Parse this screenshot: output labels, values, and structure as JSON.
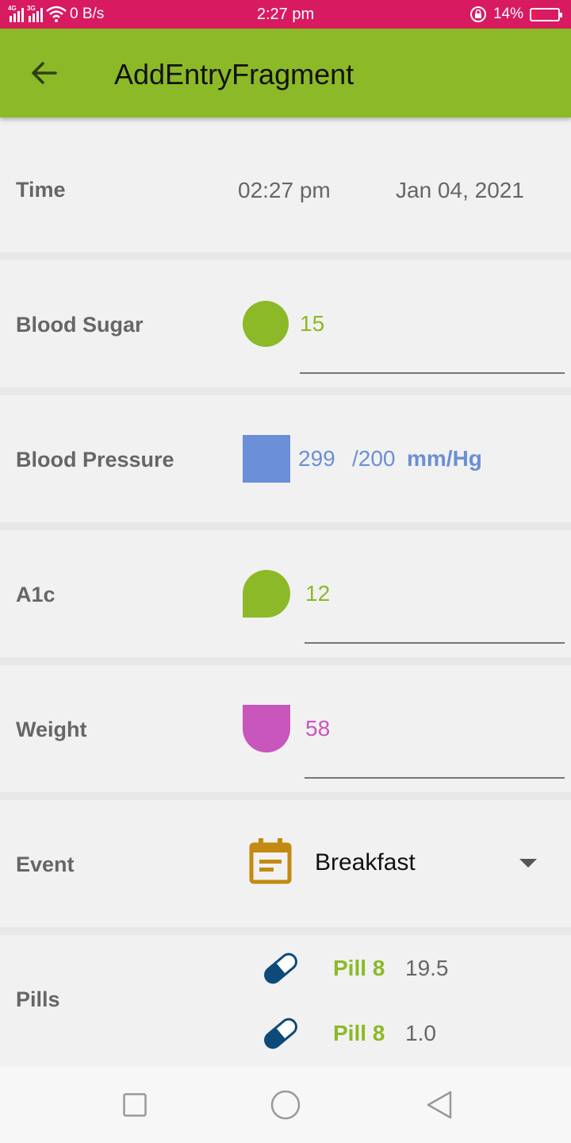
{
  "status_bar": {
    "net1": "4G",
    "net2": "3G",
    "speed": "0 B/s",
    "time": "2:27 pm",
    "battery": "14%",
    "battery_level": 0.14
  },
  "app_bar": {
    "title": "AddEntryFragment"
  },
  "form": {
    "time": {
      "label": "Time",
      "time_value": "02:27 pm",
      "date_value": "Jan 04, 2021"
    },
    "blood_sugar": {
      "label": "Blood Sugar",
      "value": "15",
      "color": "#8cb927"
    },
    "blood_pressure": {
      "label": "Blood Pressure",
      "systolic": "299",
      "diastolic": "/200",
      "unit": "mm/Hg",
      "color": "#6b8fd6"
    },
    "a1c": {
      "label": "A1c",
      "value": "12",
      "color": "#8cb927"
    },
    "weight": {
      "label": "Weight",
      "value": "58",
      "color": "#c856bd"
    },
    "event": {
      "label": "Event",
      "selected": "Breakfast",
      "icon": "calendar-note-icon",
      "icon_color": "#c28a11"
    },
    "pills": {
      "label": "Pills",
      "items": [
        {
          "name": "Pill 8",
          "amount": "19.5"
        },
        {
          "name": "Pill 8",
          "amount": "1.0"
        }
      ],
      "icon_color": "#0d4a7a"
    }
  },
  "nav_bar": {
    "buttons": [
      "recents",
      "home",
      "back"
    ]
  }
}
